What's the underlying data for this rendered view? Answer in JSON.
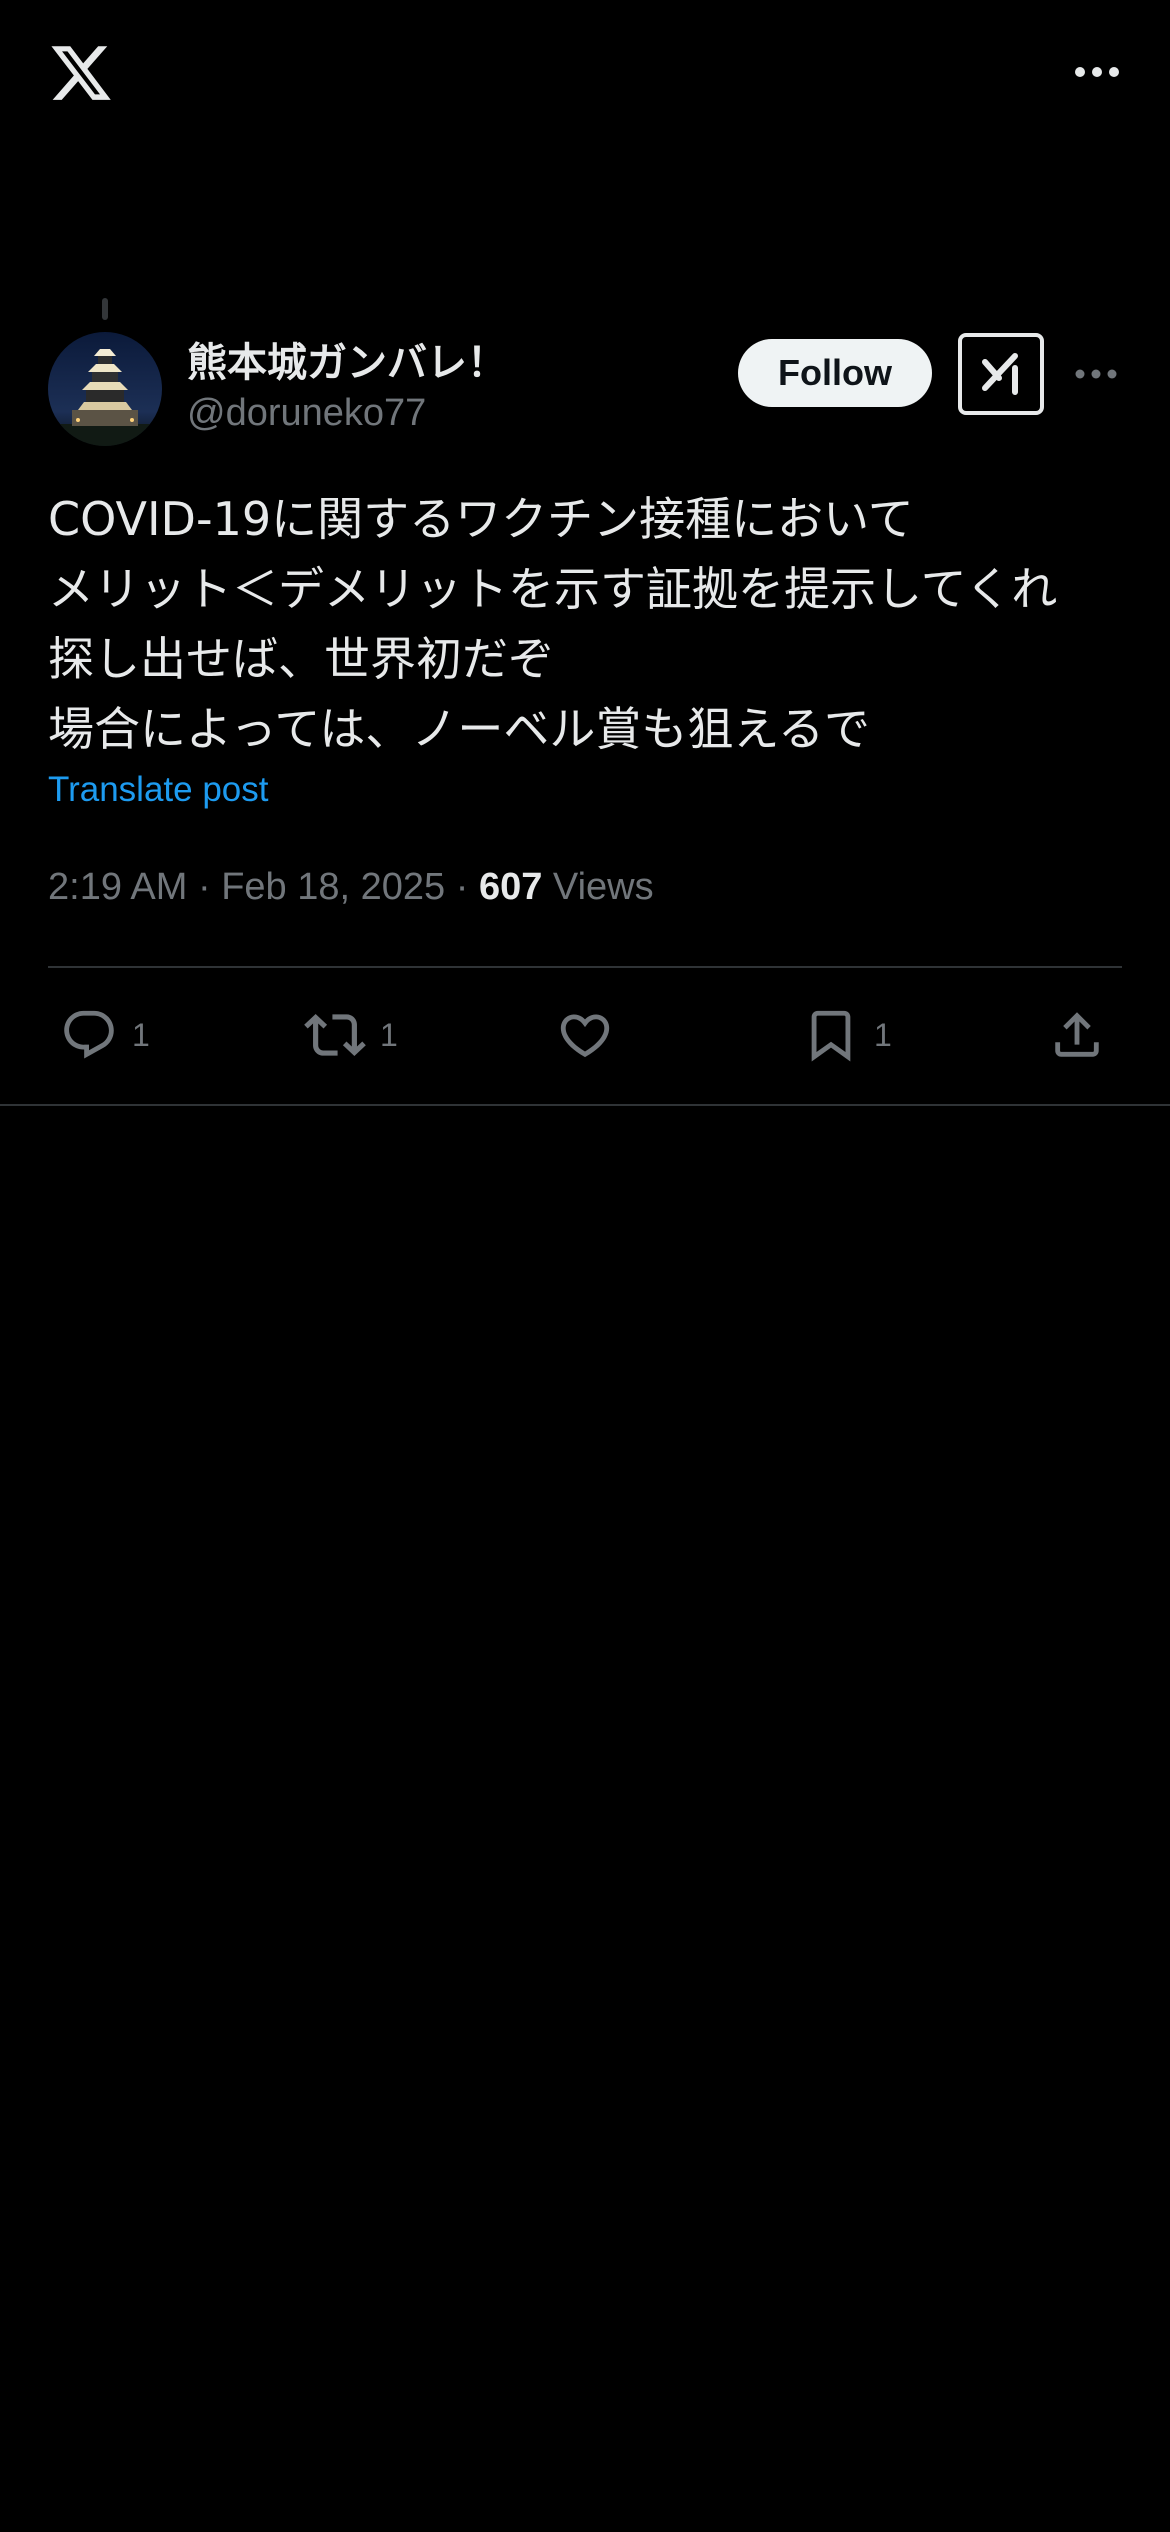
{
  "header": {
    "logo_icon": "x-logo-icon",
    "more_icon": "more-horizontal-icon"
  },
  "author": {
    "display_name": "熊本城ガンバレ！",
    "handle": "@doruneko77",
    "avatar_icon": "castle-at-night-avatar",
    "follow_label": "Follow",
    "grok_icon": "grok-icon",
    "more_icon": "more-horizontal-icon"
  },
  "post": {
    "lines": [
      "COVID-19に関するワクチン接種において",
      "メリット＜デメリットを示す証拠を提示してくれ",
      "探し出せば、世界初だぞ",
      "場合によっては、ノーベル賞も狙えるで"
    ],
    "translate_label": "Translate post"
  },
  "meta": {
    "time": "2:19 AM",
    "separator": "·",
    "date": "Feb 18, 2025",
    "views_count": "607",
    "views_label": "Views"
  },
  "actions": {
    "reply_count": "1",
    "repost_count": "1",
    "bookmark_count": "1"
  },
  "colors": {
    "background": "#000000",
    "text": "#e7e9ea",
    "secondary": "#71767b",
    "link": "#1d9bf0",
    "divider": "#2f3336"
  }
}
